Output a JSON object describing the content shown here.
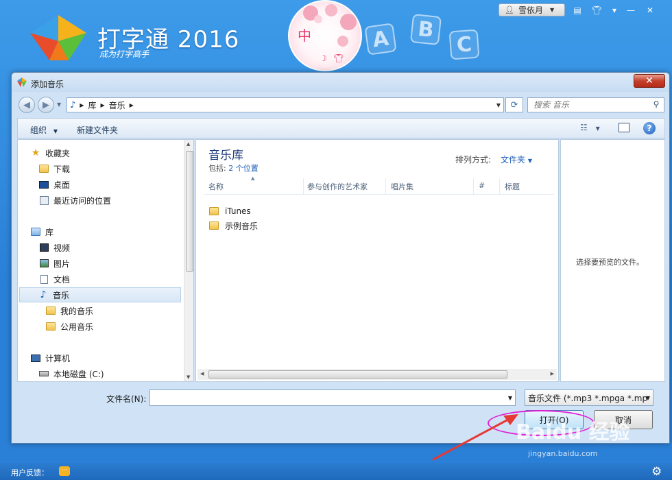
{
  "app": {
    "title": "打字通 2016",
    "slogan": "成为打字高手",
    "ime_label": "中",
    "abc": [
      "A",
      "B",
      "C"
    ],
    "user_name": "雪依月"
  },
  "dialog": {
    "title": "添加音乐",
    "breadcrumb": [
      "库",
      "音乐"
    ],
    "search_placeholder": "搜索 音乐",
    "toolbar": {
      "organize": "组织",
      "new_folder": "新建文件夹"
    },
    "nav": {
      "favorites": "收藏夹",
      "favorites_items": [
        "下载",
        "桌面",
        "最近访问的位置"
      ],
      "library": "库",
      "library_items": [
        "视频",
        "图片",
        "文档",
        "音乐"
      ],
      "music_sub": [
        "我的音乐",
        "公用音乐"
      ],
      "computer": "计算机",
      "computer_items": [
        "本地磁盘 (C:)"
      ]
    },
    "main": {
      "library_title": "音乐库",
      "includes_label": "包括:",
      "includes_link": "2 个位置",
      "sort_label": "排列方式:",
      "sort_value": "文件夹",
      "columns": [
        "名称",
        "参与创作的艺术家",
        "唱片集",
        "#",
        "标题"
      ],
      "files": [
        "iTunes",
        "示例音乐"
      ]
    },
    "preview_text": "选择要预览的文件。",
    "filename_label": "文件名(N):",
    "filter_value": "音乐文件 (*.mp3 *.mpga *.mp",
    "open_button": "打开(O)",
    "cancel_button": "取消"
  },
  "status": {
    "feedback_label": "用户反馈："
  },
  "watermark": {
    "brand": "Baidu 经验",
    "url": "jingyan.baidu.com"
  },
  "colors": {
    "accent": "#2a7fd6",
    "highlight": "#e11fd6",
    "arrow": "#e53935",
    "link": "#1f5fb8"
  }
}
